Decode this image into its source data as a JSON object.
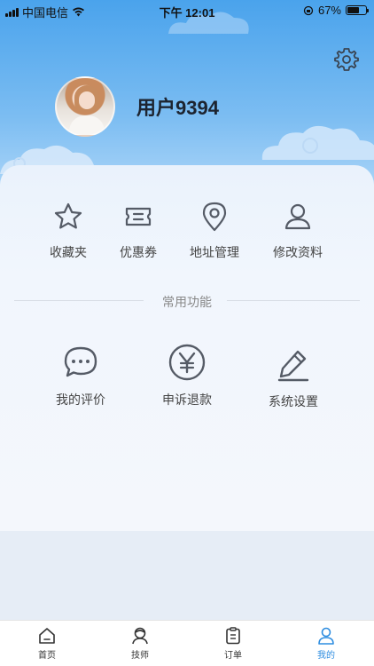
{
  "status_bar": {
    "carrier": "中国电信",
    "time": "下午 12:01",
    "battery": "67%",
    "battery_level": 0.67
  },
  "profile": {
    "username": "用户9394"
  },
  "quick_actions": [
    {
      "label": "收藏夹",
      "icon": "star-icon"
    },
    {
      "label": "优惠券",
      "icon": "coupon-icon"
    },
    {
      "label": "地址管理",
      "icon": "location-pin-icon"
    },
    {
      "label": "修改资料",
      "icon": "user-icon"
    }
  ],
  "section": {
    "title": "常用功能"
  },
  "functions": [
    {
      "label": "我的评价",
      "icon": "chat-bubble-icon"
    },
    {
      "label": "申诉退款",
      "icon": "yen-circle-icon"
    },
    {
      "label": "系统设置",
      "icon": "pencil-icon"
    }
  ],
  "tabbar": {
    "items": [
      {
        "label": "首页",
        "icon": "home-icon"
      },
      {
        "label": "技师",
        "icon": "technician-icon"
      },
      {
        "label": "订单",
        "icon": "clipboard-icon"
      },
      {
        "label": "我的",
        "icon": "profile-icon",
        "active": true
      }
    ]
  },
  "colors": {
    "header_gradient_top": "#4aa3ec",
    "accent": "#2e8de0",
    "icon_gray": "#555b66"
  }
}
